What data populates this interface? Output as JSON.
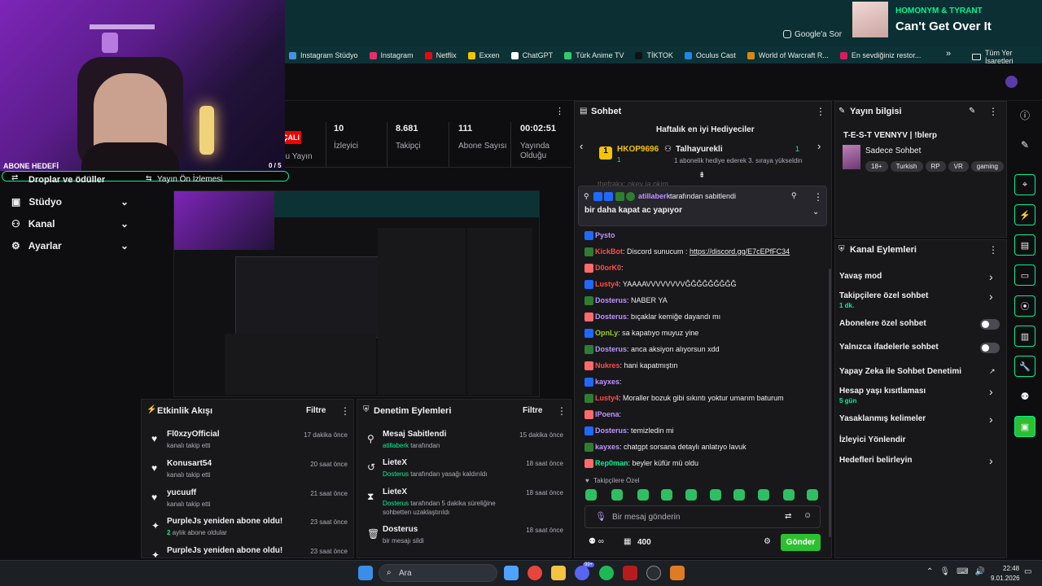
{
  "browser": {
    "google_sor": "Google'a Sor",
    "bookmarks": [
      "Instagram Stüdyo",
      "Instagram",
      "Netflix",
      "Exxen",
      "ChatGPT",
      "Türk Anime TV",
      "TİKTOK",
      "Oculus Cast",
      "World of Warcraft R...",
      "En sevdiğiniz restor..."
    ],
    "more": "»",
    "all_bookmarks": "Tüm Yer İşaretleri",
    "bookmark_colors": [
      "#4a90e2",
      "#e1306c",
      "#e50914",
      "#f5c400",
      "#ffffff",
      "#2ecc71",
      "#111111",
      "#1e88e5",
      "#d68910",
      "#d81b60"
    ]
  },
  "now_playing": {
    "artist": "HOMONYM & TYRANT",
    "title": "Can't Get Over It"
  },
  "webcam": {
    "goal_label": "ABONE HEDEFİ",
    "goal_value": "0 / 5",
    "goal_fill": 0
  },
  "left_nav": {
    "items": [
      {
        "label": "Droplar ve ödüller"
      },
      {
        "label": "Stüdyo"
      },
      {
        "label": "Kanal"
      },
      {
        "label": "Ayarlar"
      }
    ],
    "preview_tab": "Yayın Ön İzlemesi"
  },
  "stats": {
    "live_badge": "ÇALI",
    "partial_label": "du Yayın",
    "items": [
      {
        "value": "10",
        "label": "İzleyici"
      },
      {
        "value": "8.681",
        "label": "Takipçi"
      },
      {
        "value": "111",
        "label": "Abone Sayısı"
      },
      {
        "value": "00:02:51",
        "label": "Yayında Olduğu"
      }
    ]
  },
  "activity": {
    "title": "Etkinlik Akışı",
    "filter": "Filtre",
    "items": [
      {
        "name": "Fl0xzyOfficial",
        "desc": "kanalı takip etti",
        "time": "17 dakika önce"
      },
      {
        "name": "Konusart54",
        "desc": "kanalı takip etti",
        "time": "20 saat önce"
      },
      {
        "name": "yucuuff",
        "desc": "kanalı takip etti",
        "time": "21 saat önce"
      },
      {
        "name": "PurpleJs yeniden abone oldu!",
        "desc_num": "2",
        "desc": " aylık abone oldular",
        "time": "23 saat önce"
      },
      {
        "name": "PurpleJs yeniden abone oldu!",
        "desc": "",
        "time": "23 saat önce"
      }
    ]
  },
  "moderation": {
    "title": "Denetim Eylemleri",
    "filter": "Filtre",
    "items": [
      {
        "title": "Mesaj Sabitlendi",
        "user": "atillaberk",
        "desc": " tarafından",
        "time": "15 dakika önce"
      },
      {
        "title": "LieteX",
        "user": "Dosterus",
        "desc": " tarafından yasağı kaldırıldı",
        "time": "18 saat önce"
      },
      {
        "title": "LieteX",
        "user": "Dosterus",
        "desc": " tarafından 5 dakika süreliğine sohbetten uzaklaştırıldı",
        "time": "18 saat önce"
      },
      {
        "title": "Dosterus",
        "user": "",
        "desc": "bir mesajı sildi",
        "time": "18 saat önce"
      }
    ]
  },
  "chat": {
    "title": "Sohbet",
    "gifters_title": "Haftalık en iyi Hediyeciler",
    "gifter1": {
      "name": "HKOP9696",
      "count": "1"
    },
    "gifter2": {
      "name": "Talhayurekli",
      "count": "1",
      "note": "1 abonelik hediye ederek 3. sıraya yükseldin"
    },
    "partial_msg": "thefrakx: okey ja okim",
    "pinned": {
      "user": "atillaberk",
      "suffix": "tarafından sabitlendi",
      "text": "bir daha kapat ac yapıyor"
    },
    "messages": [
      {
        "user": "Pysto",
        "color": "#bf94ff",
        "text": ""
      },
      {
        "user": "KickBot",
        "color": "#ff4d4d",
        "text": ": Discord sunucum : ",
        "link": "https://discord.gg/E7cEPfFC34"
      },
      {
        "user": "D0orK0",
        "color": "#ff4d4d",
        "text": ":"
      },
      {
        "user": "Lusty4",
        "color": "#ff4d4d",
        "text": ": YAAAAVVVVVVVVĞĞĞĞĞĞĞĞĞ"
      },
      {
        "user": "Dosterus",
        "color": "#bf94ff",
        "text": ": NABER YA"
      },
      {
        "user": "Dosterus",
        "color": "#bf94ff",
        "text": ": bıçaklar kemiğe dayandı mı"
      },
      {
        "user": "OpnLy",
        "color": "#9acd32",
        "text": ": sa kapatıyo muyuz yine"
      },
      {
        "user": "Dosterus",
        "color": "#bf94ff",
        "text": ": anca aksiyon alıyorsun xdd"
      },
      {
        "user": "Nukres",
        "color": "#ff4d4d",
        "text": ": hani kapatmıştın"
      },
      {
        "user": "kayxes",
        "color": "#bf94ff",
        "text": ":"
      },
      {
        "user": "Lusty4",
        "color": "#ff4d4d",
        "text": ": Moraller bozuk gibi sıkıntı yoktur umarım baturum"
      },
      {
        "user": "IPoena",
        "color": "#bf94ff",
        "text": ":"
      },
      {
        "user": "Dosterus",
        "color": "#bf94ff",
        "text": ": temizledin mi"
      },
      {
        "user": "kayxes",
        "color": "#bf94ff",
        "text": ": chatgpt sorsana detaylı anlatıyo lavuk"
      },
      {
        "user": "Rep0man",
        "color": "#00f593",
        "text": ": beyler küfür mü oldu"
      }
    ],
    "followers_only": "Takipçilere Özel",
    "input_placeholder": "Bir mesaj gönderin",
    "points": "400",
    "send": "Gönder"
  },
  "stream_info": {
    "title": "Yayın bilgisi",
    "stream_title": "T-E-S-T  VENNYV | !blerp",
    "category": "Sadece Sohbet",
    "tags": [
      "18+",
      "Turkish",
      "RP",
      "VR",
      "gaming"
    ]
  },
  "channel_actions": {
    "title": "Kanal Eylemleri",
    "items": [
      {
        "label": "Yavaş mod",
        "sub": "",
        "control": "arrow"
      },
      {
        "label": "Takipçilere özel sohbet",
        "sub": "1 dk.",
        "control": "arrow"
      },
      {
        "label": "Abonelere özel sohbet",
        "sub": "",
        "control": "toggle"
      },
      {
        "label": "Yalnızca ifadelerle sohbet",
        "sub": "",
        "control": "toggle"
      },
      {
        "label": "Yapay Zeka ile Sohbet Denetimi",
        "sub": "",
        "control": "ext"
      },
      {
        "label": "Hesap yaşı kısıtlaması",
        "sub": "5 gün",
        "control": "arrow"
      },
      {
        "label": "Yasaklanmış kelimeler",
        "sub": "",
        "control": "arrow"
      },
      {
        "label": "İzleyici Yönlendir",
        "sub": "",
        "control": "none"
      },
      {
        "label": "Hedefleri belirleyin",
        "sub": "",
        "control": "arrow"
      }
    ]
  },
  "taskbar": {
    "search": "Ara",
    "time": "22:48",
    "date": "9.01.2026",
    "badge": "99+"
  }
}
